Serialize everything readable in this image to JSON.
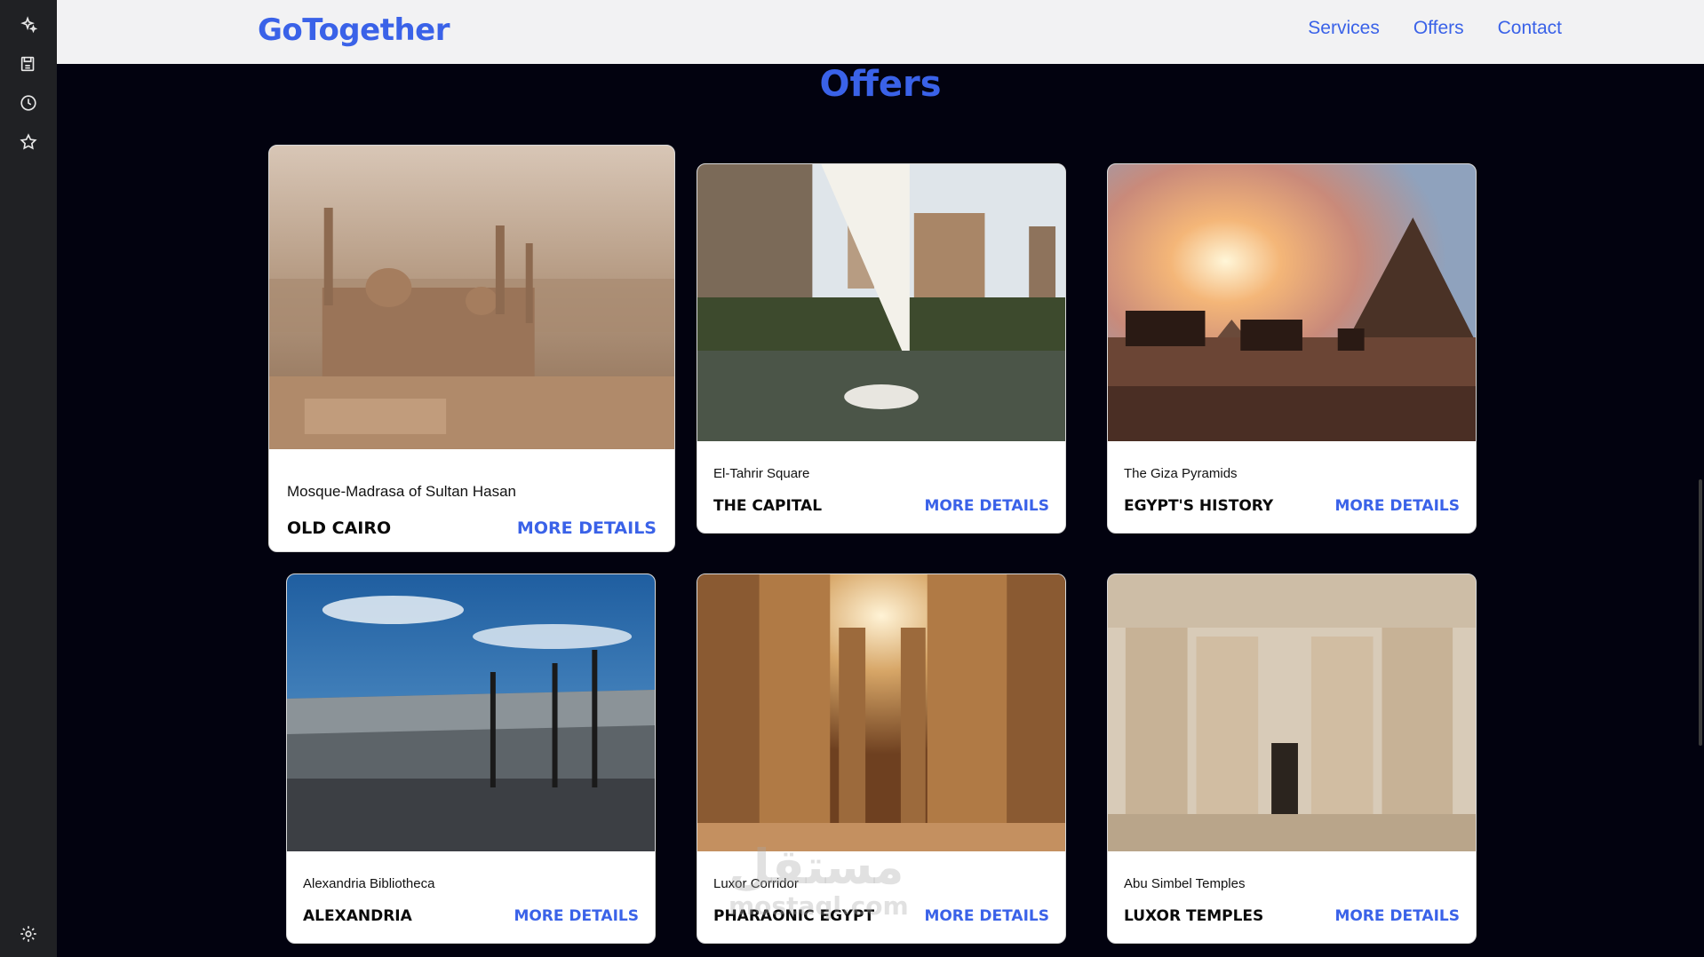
{
  "brand": "GoTogether",
  "nav": [
    "Services",
    "Offers",
    "Contact"
  ],
  "section_title": "Offers",
  "colors": {
    "accent": "#3a62e8",
    "page_bg": "#02020f",
    "navbar_bg": "#f2f2f3",
    "rail_bg": "#202124"
  },
  "sidebar_icons": [
    "sparkle-icon",
    "save-icon",
    "history-icon",
    "star-icon",
    "settings-icon"
  ],
  "cards": [
    {
      "subtitle": "Mosque-Madrasa of Sultan Hasan",
      "title": "OLD CAIRO",
      "link": "MORE DETAILS",
      "image": "cairo-mosques-photo"
    },
    {
      "subtitle": "El-Tahrir Square",
      "title": "THE CAPITAL",
      "link": "MORE DETAILS",
      "image": "nile-felucca-photo"
    },
    {
      "subtitle": "The Giza Pyramids",
      "title": "EGYPT'S HISTORY",
      "link": "MORE DETAILS",
      "image": "pyramids-camels-photo"
    },
    {
      "subtitle": "Alexandria Bibliotheca",
      "title": "ALEXANDRIA",
      "link": "MORE DETAILS",
      "image": "bibliotheca-photo"
    },
    {
      "subtitle": "Luxor Corridor",
      "title": "PHARAONIC EGYPT",
      "link": "MORE DETAILS",
      "image": "luxor-columns-photo"
    },
    {
      "subtitle": "Abu Simbel Temples",
      "title": "LUXOR TEMPLES",
      "link": "MORE DETAILS",
      "image": "abu-simbel-photo"
    }
  ],
  "watermark": {
    "arabic": "مستقل",
    "latin": "mostaql.com"
  }
}
